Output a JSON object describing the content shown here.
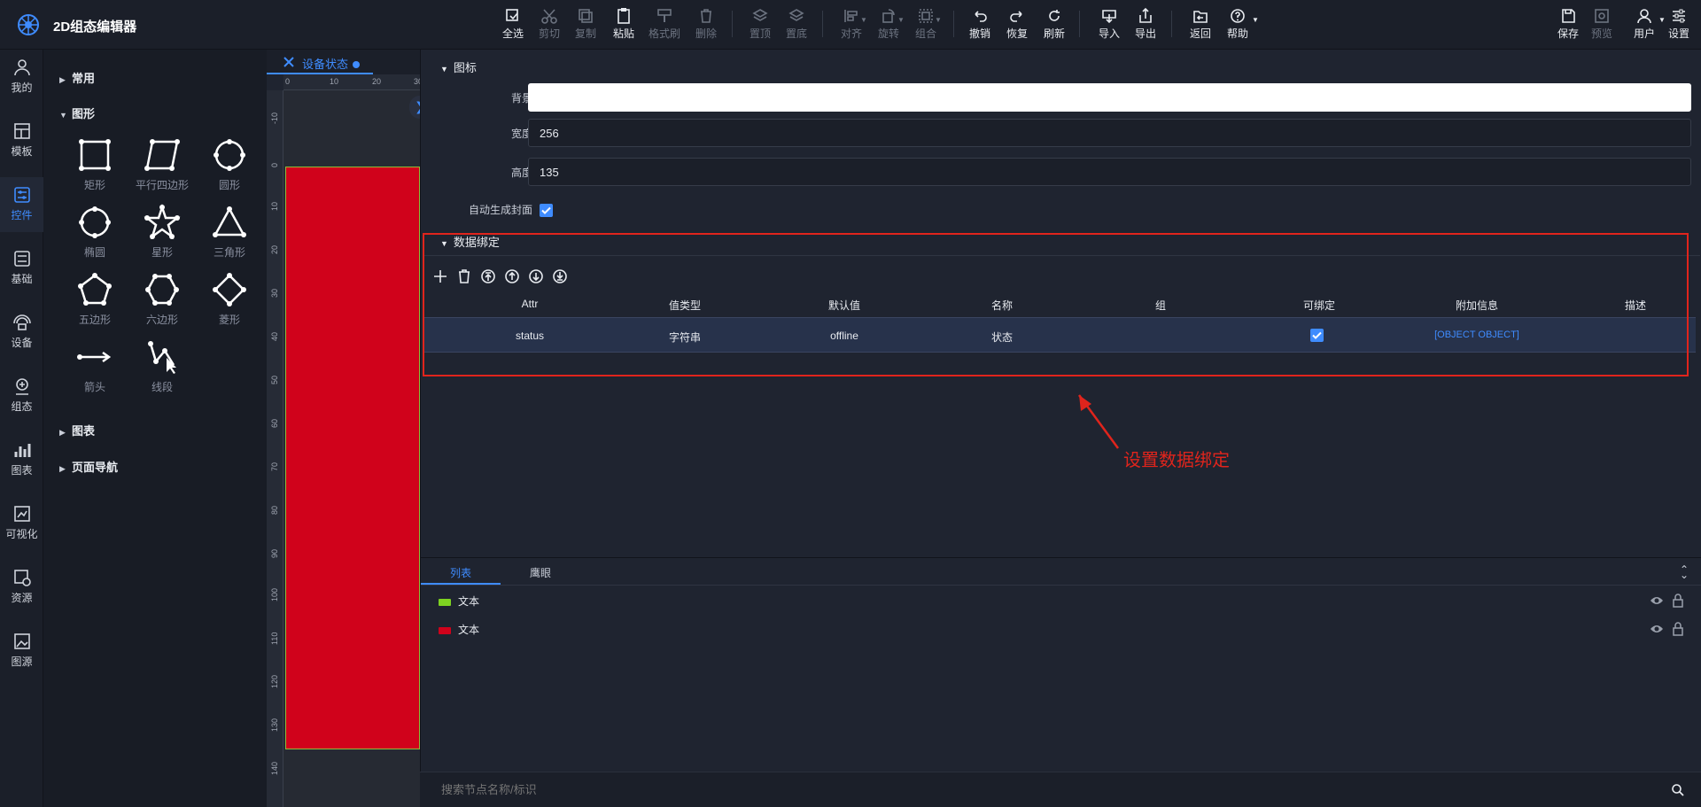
{
  "app": {
    "title": "2D组态编辑器"
  },
  "toolbar": {
    "items": [
      {
        "label": "全选",
        "enabled": true
      },
      {
        "label": "剪切",
        "enabled": false
      },
      {
        "label": "复制",
        "enabled": false
      },
      {
        "label": "粘贴",
        "enabled": true
      },
      {
        "label": "格式刷",
        "enabled": false
      },
      {
        "label": "删除",
        "enabled": false
      },
      {
        "label": "置顶",
        "enabled": false
      },
      {
        "label": "置底",
        "enabled": false
      },
      {
        "label": "对齐",
        "enabled": false
      },
      {
        "label": "旋转",
        "enabled": false
      },
      {
        "label": "组合",
        "enabled": false
      },
      {
        "label": "撤销",
        "enabled": true
      },
      {
        "label": "恢复",
        "enabled": true
      },
      {
        "label": "刷新",
        "enabled": true
      },
      {
        "label": "导入",
        "enabled": true
      },
      {
        "label": "导出",
        "enabled": true
      },
      {
        "label": "返回",
        "enabled": true
      },
      {
        "label": "帮助",
        "enabled": true
      }
    ],
    "right": [
      {
        "label": "保存",
        "enabled": true
      },
      {
        "label": "预览",
        "enabled": false
      },
      {
        "label": "用户",
        "enabled": true
      },
      {
        "label": "设置",
        "enabled": true
      }
    ]
  },
  "leftnav": {
    "items": [
      "我的",
      "模板",
      "控件",
      "基础",
      "设备",
      "组态",
      "图表",
      "可视化",
      "资源",
      "图源"
    ],
    "active": "控件"
  },
  "palette": {
    "categories": {
      "common": "常用",
      "shapes": "图形",
      "charts": "图表",
      "nav": "页面导航"
    },
    "shapes": [
      "矩形",
      "平行四边形",
      "圆形",
      "椭圆",
      "星形",
      "三角形",
      "五边形",
      "六边形",
      "菱形",
      "箭头",
      "线段"
    ]
  },
  "document": {
    "tab_title": "设备状态"
  },
  "ruler": {
    "h_ticks": [
      "0",
      "10",
      "20",
      "30"
    ],
    "v_ticks": [
      "-10",
      "0",
      "10",
      "20",
      "30",
      "40",
      "50",
      "60",
      "70",
      "80",
      "90",
      "100",
      "110",
      "120",
      "130",
      "140"
    ]
  },
  "props": {
    "icon_section": "图标",
    "background_label": "背景",
    "background_value": "",
    "width_label": "宽度",
    "width_value": "256",
    "height_label": "高度",
    "height_value": "135",
    "autocover_label": "自动生成封面",
    "autocover_checked": true
  },
  "binding": {
    "section": "数据绑定",
    "columns": [
      "Attr",
      "值类型",
      "默认值",
      "名称",
      "组",
      "可绑定",
      "附加信息",
      "描述"
    ],
    "rows": [
      {
        "attr": "status",
        "type": "字符串",
        "default": "offline",
        "name": "状态",
        "group": "",
        "bindable": true,
        "extra": "[OBJECT OBJECT]",
        "desc": ""
      }
    ]
  },
  "annotation": {
    "text": "设置数据绑定"
  },
  "bottom": {
    "tabs": [
      "列表",
      "鹰眼"
    ],
    "active_tab": "列表",
    "layers": [
      {
        "name": "文本",
        "color": "#7ed321"
      },
      {
        "name": "文本",
        "color": "#d0021b"
      }
    ],
    "search_placeholder": "搜索节点名称/标识"
  },
  "colors": {
    "accent": "#3f8cff",
    "annotation": "#e0241c",
    "canvas_shape": "#d0021b"
  }
}
